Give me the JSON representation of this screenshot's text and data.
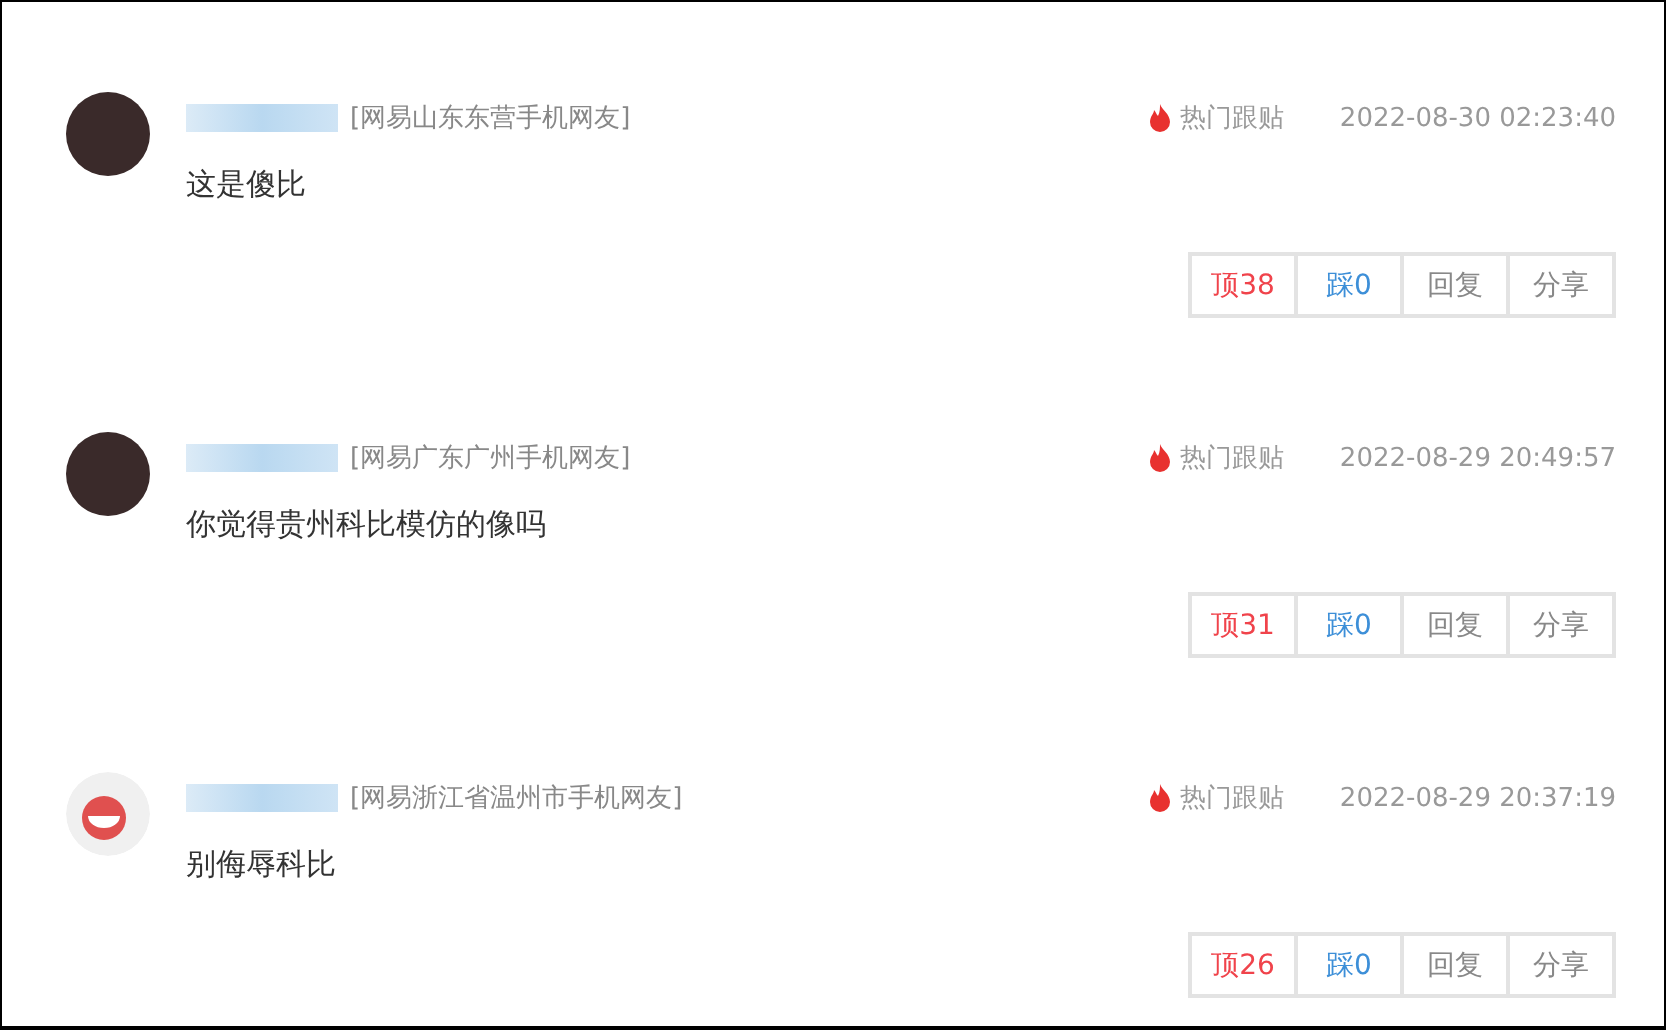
{
  "comments": [
    {
      "avatar": {
        "kind": "photo"
      },
      "source": "[网易山东东营手机网友]",
      "hot_label": "热门跟贴",
      "time": "2022-08-30 02:23:40",
      "text": "这是傻比",
      "actions": [
        {
          "kind": "up",
          "label": "顶38"
        },
        {
          "kind": "down",
          "label": "踩0"
        },
        {
          "kind": "plain",
          "label": "回复"
        },
        {
          "kind": "plain",
          "label": "分享"
        }
      ]
    },
    {
      "avatar": {
        "kind": "photo"
      },
      "source": "[网易广东广州手机网友]",
      "hot_label": "热门跟贴",
      "time": "2022-08-29 20:49:57",
      "text": "你觉得贵州科比模仿的像吗",
      "actions": [
        {
          "kind": "up",
          "label": "顶31"
        },
        {
          "kind": "down",
          "label": "踩0"
        },
        {
          "kind": "plain",
          "label": "回复"
        },
        {
          "kind": "plain",
          "label": "分享"
        }
      ]
    },
    {
      "avatar": {
        "kind": "logo"
      },
      "source": "[网易浙江省温州市手机网友]",
      "hot_label": "热门跟贴",
      "time": "2022-08-29 20:37:19",
      "text": "别侮辱科比",
      "actions": [
        {
          "kind": "up",
          "label": "顶26"
        },
        {
          "kind": "down",
          "label": "踩0"
        },
        {
          "kind": "plain",
          "label": "回复"
        },
        {
          "kind": "plain",
          "label": "分享"
        }
      ]
    }
  ]
}
